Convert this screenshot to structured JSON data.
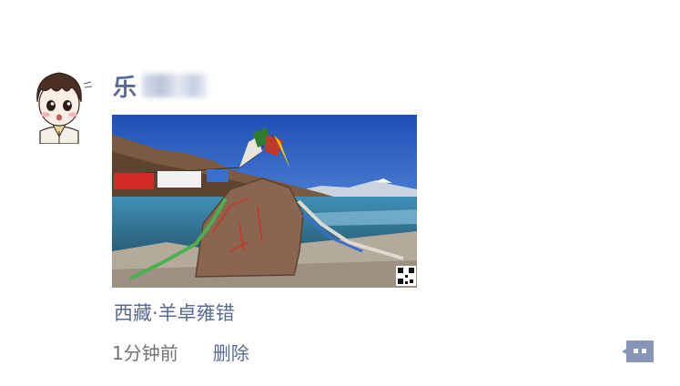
{
  "post": {
    "username_visible": "乐",
    "location": "西藏·羊卓雍错",
    "time": "1分钟前",
    "delete_label": "删除"
  },
  "icons": {
    "avatar": "cartoon-avatar-icon",
    "comment": "comment-bubble-icon",
    "qr": "qr-code-icon"
  },
  "colors": {
    "link": "#576b95",
    "meta": "#737373",
    "comment_button": "#8796b8"
  }
}
